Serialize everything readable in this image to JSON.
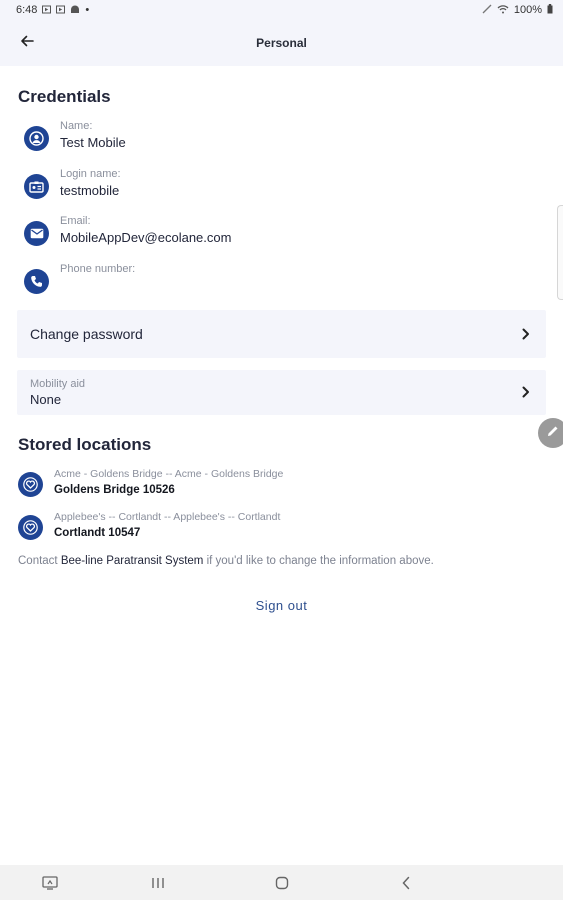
{
  "status_bar": {
    "time": "6:48",
    "battery": "100%",
    "dot": "•"
  },
  "app_bar": {
    "title": "Personal"
  },
  "credentials": {
    "section_title": "Credentials",
    "fields": [
      {
        "label": "Name:",
        "value": "Test Mobile",
        "icon": "person-icon"
      },
      {
        "label": "Login name:",
        "value": "testmobile",
        "icon": "id-card-icon"
      },
      {
        "label": "Email:",
        "value": "MobileAppDev@ecolane.com",
        "icon": "mail-icon"
      },
      {
        "label": "Phone number:",
        "value": "",
        "icon": "phone-icon"
      }
    ]
  },
  "change_password": {
    "label": "Change password"
  },
  "mobility_aid": {
    "label": "Mobility aid",
    "value": "None"
  },
  "stored_locations": {
    "section_title": "Stored locations",
    "items": [
      {
        "subtitle": "Acme - Goldens Bridge -- Acme - Goldens Bridge",
        "title": "Goldens Bridge 10526",
        "icon": "heart-icon"
      },
      {
        "subtitle": "Applebee's -- Cortlandt -- Applebee's -- Cortlandt",
        "title": "Cortlandt 10547",
        "icon": "heart-icon"
      }
    ]
  },
  "contact": {
    "prefix": "Contact",
    "org": "Bee-line Paratransit System",
    "suffix": "if you'd like to change the information above."
  },
  "sign_out": {
    "label": "Sign out"
  },
  "colors": {
    "accent": "#1f4494",
    "bar_background": "#f4f5fb",
    "link": "#2e4f8e"
  }
}
